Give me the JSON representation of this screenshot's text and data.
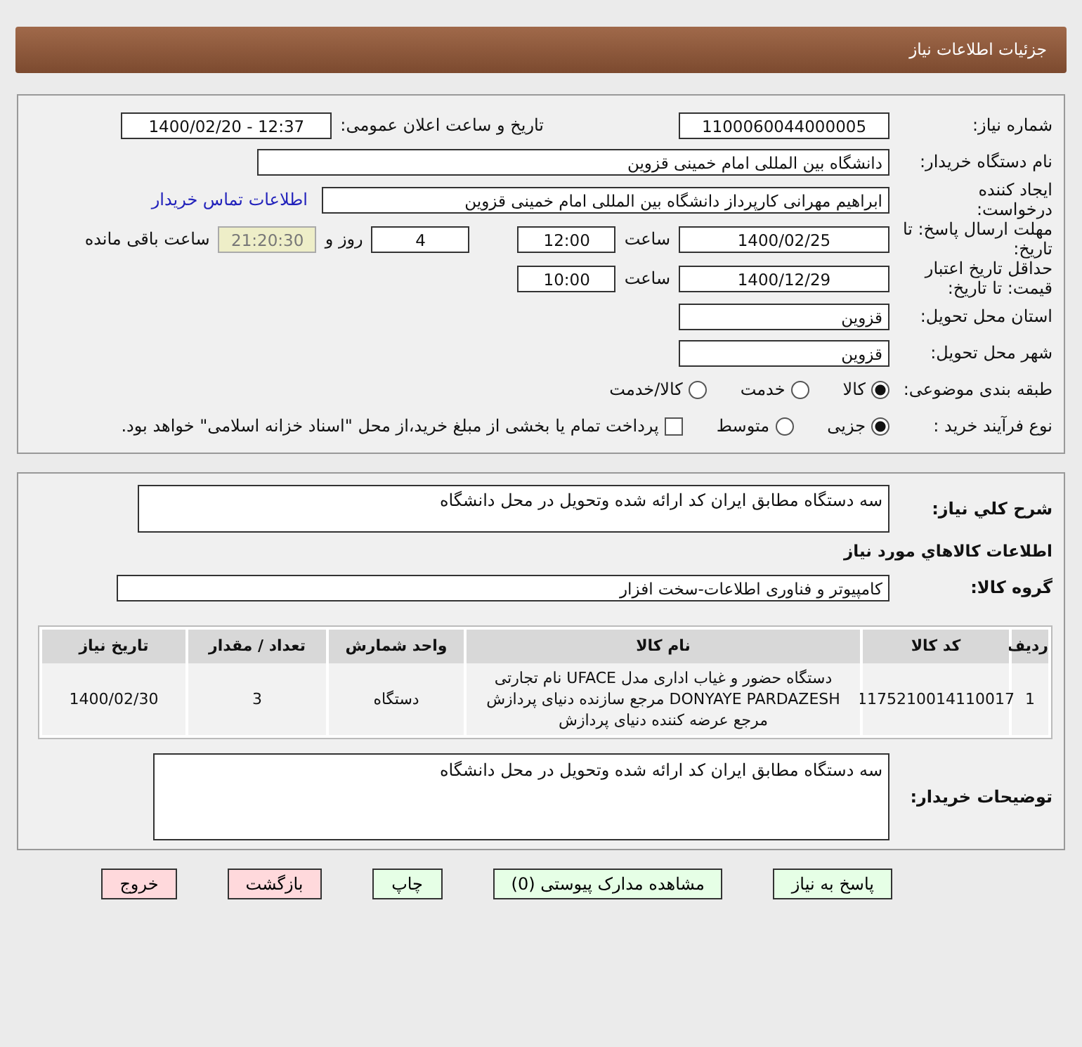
{
  "header": {
    "title": "جزئیات اطلاعات نیاز"
  },
  "need_number": {
    "label": "شماره نیاز:",
    "value": "1100060044000005"
  },
  "announce": {
    "label": "تاریخ و ساعت اعلان عمومی:",
    "value": "1400/02/20 - 12:37"
  },
  "buyer_org": {
    "label": "نام دستگاه خریدار:",
    "value": "دانشگاه بین المللی امام خمینی قزوین"
  },
  "creator": {
    "label": "ایجاد کننده درخواست:",
    "value": "ابراهیم مهرانی کارپرداز دانشگاه بین المللی امام خمینی قزوین",
    "link": "اطلاعات تماس خریدار"
  },
  "deadline": {
    "label": "مهلت ارسال پاسخ: تا تاریخ:",
    "date": "1400/02/25",
    "time_label": "ساعت",
    "time": "12:00",
    "days": "4",
    "days_label": "روز و",
    "remaining": "21:20:30",
    "remaining_label": "ساعت باقی مانده"
  },
  "validity": {
    "label": "حداقل تاریخ اعتبار قیمت: تا تاریخ:",
    "date": "1400/12/29",
    "time_label": "ساعت",
    "time": "10:00"
  },
  "province": {
    "label": "استان محل تحویل:",
    "value": "قزوین"
  },
  "city": {
    "label": "شهر محل تحویل:",
    "value": "قزوین"
  },
  "category": {
    "label": "طبقه بندی موضوعی:",
    "options": [
      {
        "label": "کالا",
        "selected": true
      },
      {
        "label": "خدمت",
        "selected": false
      },
      {
        "label": "کالا/خدمت",
        "selected": false
      }
    ]
  },
  "process": {
    "label": "نوع فرآیند خرید :",
    "options": [
      {
        "label": "جزیی",
        "selected": true
      },
      {
        "label": "متوسط",
        "selected": false
      }
    ],
    "payment": {
      "checked": false,
      "label": "پرداخت تمام یا بخشی از مبلغ خرید،از محل \"اسناد خزانه اسلامی\" خواهد بود."
    }
  },
  "description": {
    "label": "شرح کلي نياز:",
    "value": "سه دستگاه مطابق ایران کد ارائه شده  وتحویل در محل دانشگاه"
  },
  "goods_heading": "اطلاعات کالاهاي مورد نياز",
  "group": {
    "label": "گروه کالا:",
    "value": "کامپیوتر و فناوری اطلاعات-سخت افزار"
  },
  "table": {
    "columns": [
      "ردیف",
      "کد کالا",
      "نام کالا",
      "واحد شمارش",
      "تعداد / مقدار",
      "تاریخ نیاز"
    ],
    "rows": [
      [
        "1",
        "1175210014110017",
        "دستگاه حضور و غیاب اداری مدل UFACE نام تجارتی DONYAYE PARDAZESH مرجع سازنده دنیای پردازش مرجع عرضه کننده دنیای پردازش",
        "دستگاه",
        "3",
        "1400/02/30"
      ]
    ]
  },
  "buyer_notes": {
    "label": "توضیحات خریدار:",
    "value": "سه دستگاه مطابق ایران کد ارائه شده  وتحویل در محل دانشگاه"
  },
  "buttons": [
    {
      "label": "پاسخ به نیاز",
      "color": "#e6ffe6"
    },
    {
      "label": "مشاهده مدارک پیوستی (0)",
      "color": "#e6ffe6"
    },
    {
      "label": "چاپ",
      "color": "#e6ffe6"
    },
    {
      "label": "بازگشت",
      "color": "#ffd9dc"
    },
    {
      "label": "خروج",
      "color": "#ffd9dc"
    }
  ]
}
